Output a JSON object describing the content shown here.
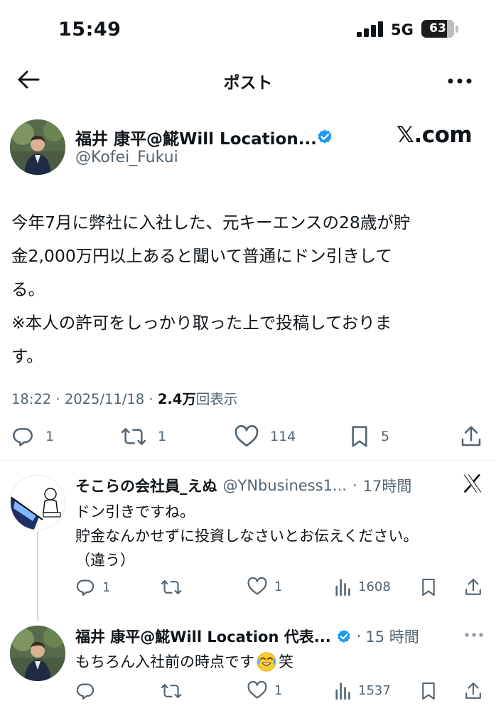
{
  "status_bar": {
    "time": "15:49",
    "network": "5G",
    "battery": "63"
  },
  "nav": {
    "title": "ポスト"
  },
  "post": {
    "author_name": "福井 康平@𩸽Will Location...",
    "handle": "@Kofei_Fukui",
    "source_badge": "𝕏.com",
    "body": "今年7月に弊社に入社した、元キーエンスの28歳が貯\n金2,000万円以上あると聞いて普通にドン引きして\nる。\n※本人の許可をしっかり取った上で投稿しておりま\nす。",
    "time": "18:22",
    "date": "2025/11/18",
    "views_count": "2.4万",
    "views_label": "回表示",
    "replies": "1",
    "reposts": "1",
    "likes": "114",
    "bookmarks": "5"
  },
  "replies": [
    {
      "name": "そこらの会社員_えぬ",
      "handle": "@YNbusiness1...",
      "time": "17時間",
      "text": "ドン引きですね。\n貯金なんかせずに投資しなさいとお伝えください。\n（違う）",
      "replies": "1",
      "reposts": "",
      "likes": "1",
      "views": "1608"
    },
    {
      "name": "福井 康平@𩸽Will Location 代表...",
      "handle": "",
      "time": "15 時間",
      "text": "もちろん入社前の時点です",
      "text_suffix": "笑",
      "emoji_icon": "laughing-tears-emoji",
      "replies": "",
      "reposts": "",
      "likes": "1",
      "views": "1537"
    }
  ],
  "colors": {
    "accent": "#1d9bf0",
    "muted": "#536471",
    "text": "#0f1419",
    "like": "#536471"
  }
}
